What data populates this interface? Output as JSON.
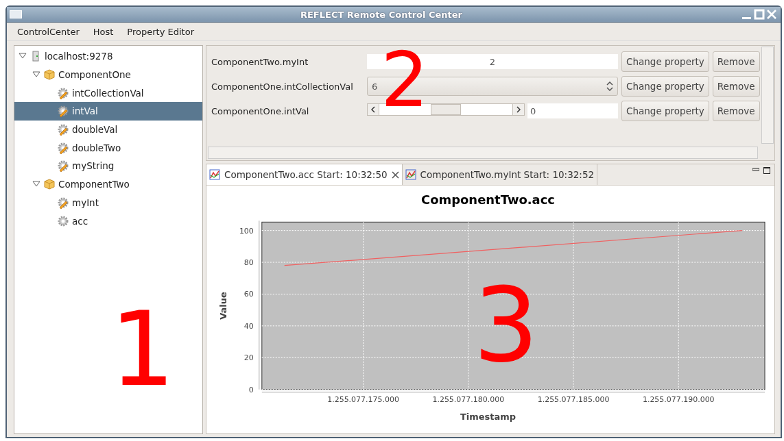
{
  "window": {
    "title": "REFLECT Remote Control Center"
  },
  "menu": [
    {
      "label": "ControlCenter"
    },
    {
      "label": "Host"
    },
    {
      "label": "Property Editor"
    }
  ],
  "tree": [
    {
      "label": "localhost:9278",
      "kind": "host",
      "expanded": true,
      "selected": false,
      "children": [
        {
          "label": "ComponentOne",
          "kind": "component",
          "expanded": true,
          "selected": false,
          "children": [
            {
              "label": "intCollectionVal",
              "kind": "property",
              "selected": false
            },
            {
              "label": "intVal",
              "kind": "property",
              "selected": true
            },
            {
              "label": "doubleVal",
              "kind": "property",
              "selected": false
            },
            {
              "label": "doubleTwo",
              "kind": "property",
              "selected": false
            },
            {
              "label": "myString",
              "kind": "property",
              "selected": false
            }
          ]
        },
        {
          "label": "ComponentTwo",
          "kind": "component",
          "expanded": true,
          "selected": false,
          "children": [
            {
              "label": "myInt",
              "kind": "property",
              "selected": false
            },
            {
              "label": "acc",
              "kind": "readonly",
              "selected": false
            }
          ]
        }
      ]
    }
  ],
  "properties": [
    {
      "name": "ComponentTwo.myInt",
      "kind": "text",
      "value": "2",
      "change_button": "Change property",
      "remove_button": "Remove"
    },
    {
      "name": "ComponentOne.intCollectionVal",
      "kind": "combo",
      "value": "6",
      "change_button": "Change property",
      "remove_button": "Remove"
    },
    {
      "name": "ComponentOne.intVal",
      "kind": "slider",
      "level": 0.5,
      "value": "0",
      "change_button": "Change property",
      "remove_button": "Remove"
    }
  ],
  "tabs": [
    {
      "label": "ComponentTwo.acc Start: 10:32:50",
      "selected": true,
      "closable": true
    },
    {
      "label": "ComponentTwo.myInt Start: 10:32:52",
      "selected": false,
      "closable": false
    }
  ],
  "chart": {
    "chart_data": {
      "type": "line",
      "title": "ComponentTwo.acc",
      "xlabel": "Timestamp",
      "ylabel": "Value",
      "x": [
        1255077171254,
        1255077193029
      ],
      "values": [
        78,
        100
      ],
      "grid": true,
      "xlim": [
        1255077170179,
        1255077194104
      ],
      "ylim": [
        0,
        105.3
      ],
      "xticks": [
        {
          "value": 1255077175000,
          "label": "1.255.077.175.000"
        },
        {
          "value": 1255077180000,
          "label": "1.255.077.180.000"
        },
        {
          "value": 1255077185000,
          "label": "1.255.077.185.000"
        },
        {
          "value": 1255077190000,
          "label": "1.255.077.190.000"
        }
      ],
      "yticks": [
        0,
        20,
        40,
        60,
        80,
        100
      ]
    }
  },
  "callouts": [
    {
      "label": "1"
    },
    {
      "label": "2"
    },
    {
      "label": "3"
    }
  ]
}
